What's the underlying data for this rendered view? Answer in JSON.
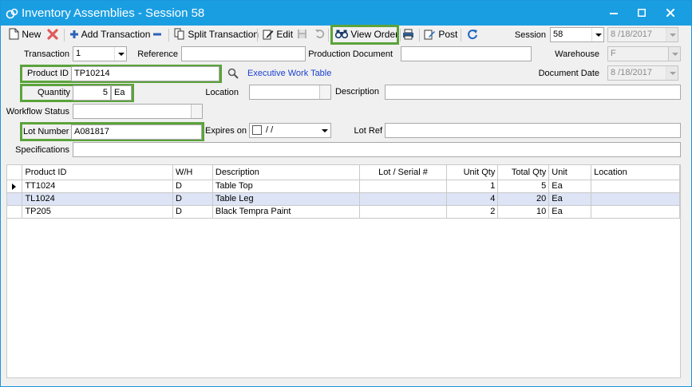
{
  "window": {
    "title": "Inventory Assemblies - Session 58"
  },
  "toolbar": {
    "new_label": "New",
    "add_transaction_label": "Add Transaction",
    "split_transaction_label": "Split Transaction",
    "edit_label": "Edit",
    "view_order_label": "View Order",
    "post_label": "Post",
    "session_label": "Session",
    "session_value": "58",
    "session_date": "8 /18/2017"
  },
  "form": {
    "transaction_label": "Transaction",
    "transaction_value": "1",
    "reference_label": "Reference",
    "reference_value": "",
    "production_document_label": "Production Document",
    "production_document_value": "",
    "warehouse_label": "Warehouse",
    "warehouse_value": "F",
    "product_id_label": "Product ID",
    "product_id_value": "TP10214",
    "product_description_link": "Executive Work Table",
    "document_date_label": "Document Date",
    "document_date_value": "8 /18/2017",
    "quantity_label": "Quantity",
    "quantity_value": "5",
    "quantity_unit": "Ea",
    "location_label": "Location",
    "location_value": "",
    "description_label": "Description",
    "description_value": "",
    "workflow_status_label": "Workflow Status",
    "workflow_status_value": "",
    "lot_number_label": "Lot Number",
    "lot_number_value": "A081817",
    "expires_on_label": "Expires on",
    "expires_on_value": "/ /",
    "lot_ref_label": "Lot Ref",
    "lot_ref_value": "",
    "specifications_label": "Specifications",
    "specifications_value": ""
  },
  "grid": {
    "headers": {
      "product_id": "Product ID",
      "wh": "W/H",
      "description": "Description",
      "lot_serial": "Lot / Serial #",
      "unit_qty": "Unit Qty",
      "total_qty": "Total Qty",
      "unit": "Unit",
      "location": "Location"
    },
    "rows": [
      {
        "product_id": "TT1024",
        "wh": "D",
        "description": "Table Top",
        "lot_serial": "",
        "unit_qty": "1",
        "total_qty": "5",
        "unit": "Ea",
        "location": ""
      },
      {
        "product_id": "TL1024",
        "wh": "D",
        "description": "Table Leg",
        "lot_serial": "",
        "unit_qty": "4",
        "total_qty": "20",
        "unit": "Ea",
        "location": ""
      },
      {
        "product_id": "TP205",
        "wh": "D",
        "description": "Black Tempra Paint",
        "lot_serial": "",
        "unit_qty": "2",
        "total_qty": "10",
        "unit": "Ea",
        "location": ""
      }
    ]
  },
  "colors": {
    "titlebar": "#1a9ee2",
    "highlight": "#5ba33b",
    "link": "#1b3fd1",
    "selected_row": "#dde4f5"
  },
  "icons": [
    "app-icon",
    "minimize-icon",
    "maximize-icon",
    "close-icon",
    "new-document-icon",
    "delete-x-icon",
    "add-plus-icon",
    "remove-minus-icon",
    "split-icon",
    "edit-pencil-icon",
    "save-disk-icon",
    "undo-icon",
    "binoculars-icon",
    "print-icon",
    "post-icon",
    "refresh-icon",
    "magnifier-icon",
    "row-indicator-icon"
  ]
}
